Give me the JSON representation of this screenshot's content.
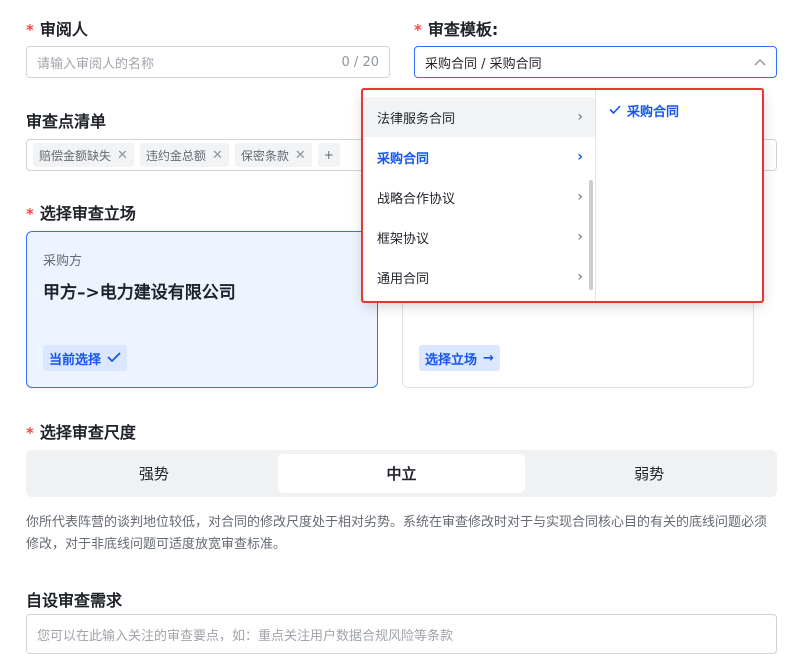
{
  "reviewer": {
    "label": "审阅人",
    "required_mark": "*",
    "placeholder": "请输入审阅人的名称",
    "counter": "0 / 20"
  },
  "template": {
    "label": "审查模板:",
    "required_mark": "*",
    "value": "采购合同 / 采购合同"
  },
  "checklist": {
    "label": "审查点清单",
    "tags": [
      "赔偿金额缺失",
      "违约金总额",
      "保密条款"
    ],
    "more": "+"
  },
  "stance": {
    "label": "选择审查立场",
    "required_mark": "*",
    "card1": {
      "role": "采购方",
      "party": "甲方–>电力建设有限公司",
      "action": "当前选择"
    },
    "card2": {
      "action": "选择立场"
    }
  },
  "scale": {
    "label": "选择审查尺度",
    "required_mark": "*",
    "options": [
      "强势",
      "中立",
      "弱势"
    ],
    "selected": "中立",
    "description": "你所代表阵营的谈判地位较低，对合同的修改尺度处于相对劣势。系统在审查修改时对于与实现合同核心目的有关的底线问题必须修改，对于非底线问题可适度放宽审查标准。"
  },
  "custom": {
    "label": "自设审查需求",
    "placeholder": "您可以在此输入关注的审查要点，如：重点关注用户数据合规风险等条款"
  },
  "cascader": {
    "level1": [
      "法律服务合同",
      "采购合同",
      "战略合作协议",
      "框架协议",
      "通用合同"
    ],
    "level1_selected": "采购合同",
    "level2": [
      "采购合同"
    ],
    "level2_selected": "采购合同"
  },
  "colors": {
    "accent": "#1456f0",
    "required": "#f54a45",
    "highlight_border": "#e8372c"
  }
}
